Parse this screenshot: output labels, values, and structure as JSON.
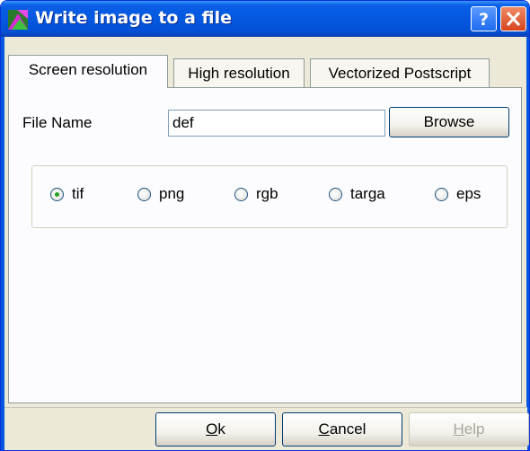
{
  "window": {
    "title": "Write image to a file",
    "help_button": "?",
    "close_button": "close"
  },
  "tabs": [
    {
      "label": "Screen resolution",
      "active": true
    },
    {
      "label": "High resolution",
      "active": false
    },
    {
      "label": "Vectorized Postscript",
      "active": false
    }
  ],
  "file": {
    "label": "File Name",
    "value": "def",
    "browse_label": "Browse"
  },
  "format_options": [
    {
      "label": "tif",
      "selected": true
    },
    {
      "label": "png",
      "selected": false
    },
    {
      "label": "rgb",
      "selected": false
    },
    {
      "label": "targa",
      "selected": false
    },
    {
      "label": "eps",
      "selected": false
    }
  ],
  "buttons": {
    "ok": {
      "mnemonic": "O",
      "rest": "k"
    },
    "cancel": {
      "mnemonic": "C",
      "rest": "ancel"
    },
    "help": {
      "mnemonic": "H",
      "rest": "elp",
      "disabled": true
    }
  },
  "colors": {
    "titlebar": "#0558E0",
    "dialog_bg": "#ECE9D8",
    "tab_body": "#FCFCFE",
    "radio_selected": "#21A121",
    "close_button": "#D6451E"
  }
}
